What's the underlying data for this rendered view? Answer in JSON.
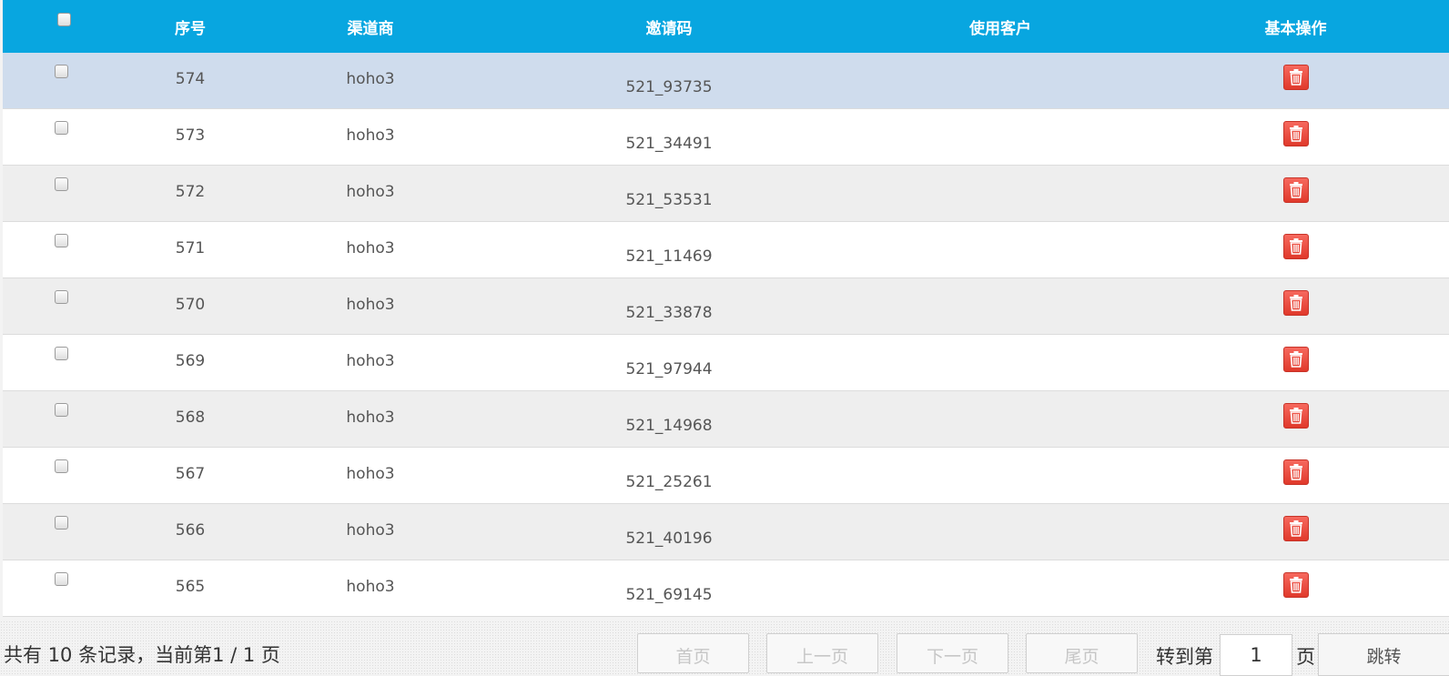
{
  "table": {
    "columns": [
      "序号",
      "渠道商",
      "邀请码",
      "使用客户",
      "基本操作"
    ],
    "rows": [
      {
        "id": "574",
        "channel": "hoho3",
        "code": "521_93735",
        "customer": ""
      },
      {
        "id": "573",
        "channel": "hoho3",
        "code": "521_34491",
        "customer": ""
      },
      {
        "id": "572",
        "channel": "hoho3",
        "code": "521_53531",
        "customer": ""
      },
      {
        "id": "571",
        "channel": "hoho3",
        "code": "521_11469",
        "customer": ""
      },
      {
        "id": "570",
        "channel": "hoho3",
        "code": "521_33878",
        "customer": ""
      },
      {
        "id": "569",
        "channel": "hoho3",
        "code": "521_97944",
        "customer": ""
      },
      {
        "id": "568",
        "channel": "hoho3",
        "code": "521_14968",
        "customer": ""
      },
      {
        "id": "567",
        "channel": "hoho3",
        "code": "521_25261",
        "customer": ""
      },
      {
        "id": "566",
        "channel": "hoho3",
        "code": "521_40196",
        "customer": ""
      },
      {
        "id": "565",
        "channel": "hoho3",
        "code": "521_69145",
        "customer": ""
      }
    ],
    "delete_icon": "trash-icon"
  },
  "pager": {
    "summary": "共有 10 条记录，当前第1 / 1 页",
    "first": "首页",
    "prev": "上一页",
    "next": "下一页",
    "last": "尾页",
    "goto_prefix": "转到第",
    "page_value": "1",
    "goto_suffix": "页",
    "jump": "跳转"
  },
  "colors": {
    "header_bg": "#08a6e0",
    "selected_row": "#cfdced",
    "delete_button": "#e8463a"
  }
}
